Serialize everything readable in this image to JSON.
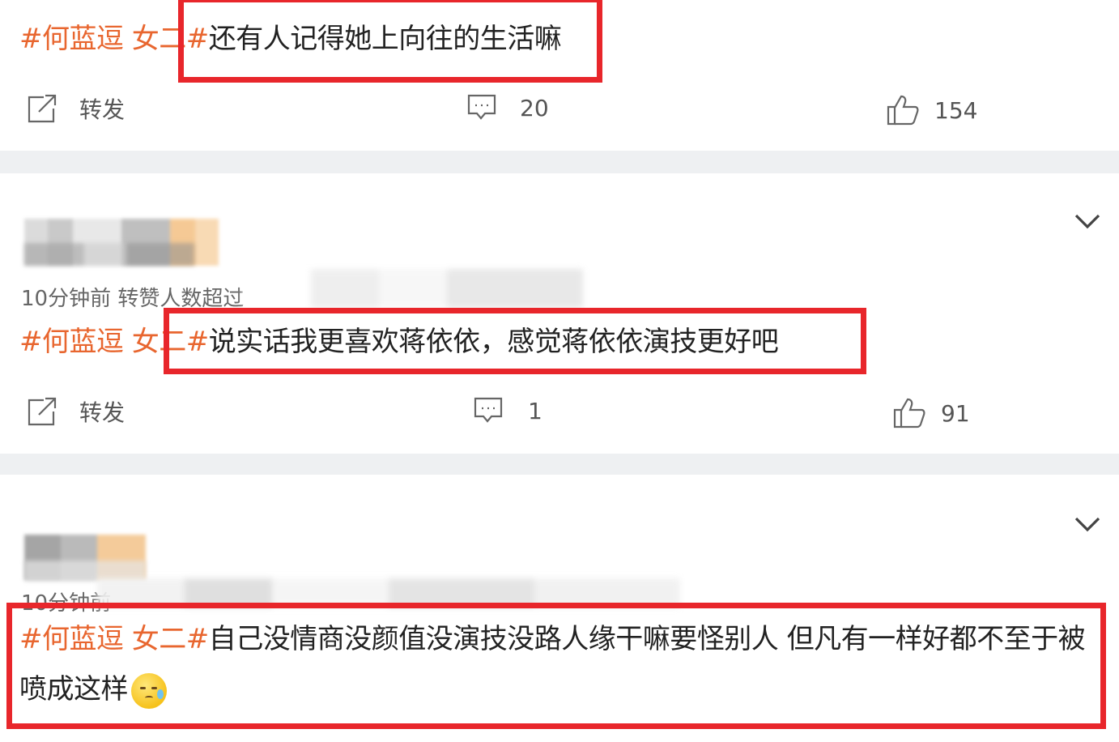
{
  "posts": [
    {
      "hashtag": "#何蓝逗 女二#",
      "text": "还有人记得她上向往的生活嘛",
      "actions": {
        "repost_label": "转发",
        "comment_count": "20",
        "like_count": "154"
      }
    },
    {
      "meta": "10分钟前 转赞人数超过",
      "hashtag": "#何蓝逗 女二#",
      "text": "说实话我更喜欢蒋依依，感觉蒋依依演技更好吧",
      "actions": {
        "repost_label": "转发",
        "comment_count": "1",
        "like_count": "91"
      }
    },
    {
      "meta": "10分钟前",
      "hashtag": "#何蓝逗 女二#",
      "text": "自己没情商没颜值没演技没路人缘干嘛要怪别人 但凡有一样好都不至于被喷成这样"
    }
  ],
  "colors": {
    "hashtag": "#e8662f",
    "highlight_border": "#e8262b",
    "divider": "#eef0f2"
  },
  "icons": [
    "repost-icon",
    "comment-icon",
    "like-icon",
    "chevron-down-icon",
    "sweat-emoji-icon"
  ]
}
